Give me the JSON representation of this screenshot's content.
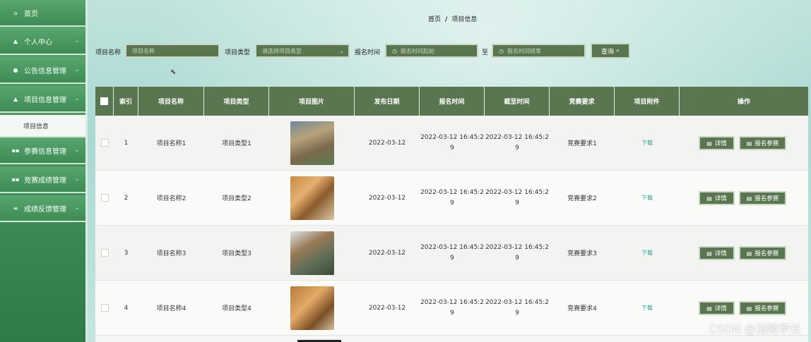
{
  "sidebar": {
    "items": [
      {
        "label": "首页",
        "icon": "home-icon",
        "glyph": "⌂"
      },
      {
        "label": "个人中心",
        "icon": "user-icon",
        "glyph": "▲"
      },
      {
        "label": "公告信息管理",
        "icon": "pin-icon",
        "glyph": "●"
      },
      {
        "label": "项目信息管理",
        "icon": "user-icon",
        "glyph": "▲"
      },
      {
        "label": "参赛信息管理",
        "icon": "grid-icon",
        "glyph": "▪▪"
      },
      {
        "label": "竞赛成绩管理",
        "icon": "grid-icon",
        "glyph": "▪▪"
      },
      {
        "label": "成绩反馈管理",
        "icon": "menu-icon",
        "glyph": "≡"
      }
    ],
    "subitem": "项目信息"
  },
  "breadcrumb": {
    "home": "首页",
    "sep": "/",
    "current": "项目信息"
  },
  "search": {
    "name_label": "项目名称",
    "name_placeholder": "项目名称",
    "type_label": "项目类型",
    "type_placeholder": "请选择项目类型",
    "time_label": "报名时间",
    "start_placeholder": "报名时间起始",
    "to_label": "至",
    "end_placeholder": "报名时间结束",
    "button": "查询"
  },
  "table": {
    "headers": [
      "索引",
      "项目名称",
      "项目类型",
      "项目图片",
      "发布日期",
      "报名时间",
      "截至时间",
      "竞赛要求",
      "项目附件",
      "操作"
    ],
    "rows": [
      {
        "index": "1",
        "name": "项目名称1",
        "type": "项目类型1",
        "date": "2022-03-12",
        "start_a": "2022-03-12 16:45:2",
        "start_b": "9",
        "end_a": "2022-03-12 16:45:2",
        "end_b": "9",
        "req": "竞赛要求1",
        "file": "下载"
      },
      {
        "index": "2",
        "name": "项目名称2",
        "type": "项目类型2",
        "date": "2022-03-12",
        "start_a": "2022-03-12 16:45:2",
        "start_b": "9",
        "end_a": "2022-03-12 16:45:2",
        "end_b": "9",
        "req": "竞赛要求2",
        "file": "下载"
      },
      {
        "index": "3",
        "name": "项目名称3",
        "type": "项目类型3",
        "date": "2022-03-12",
        "start_a": "2022-03-12 16:45:2",
        "start_b": "9",
        "end_a": "2022-03-12 16:45:2",
        "end_b": "9",
        "req": "竞赛要求3",
        "file": "下载"
      },
      {
        "index": "4",
        "name": "项目名称4",
        "type": "项目类型4",
        "date": "2022-03-12",
        "start_a": "2022-03-12 16:45:2",
        "start_b": "9",
        "end_a": "2022-03-12 16:45:2",
        "end_b": "9",
        "req": "竞赛要求4",
        "file": "下载"
      }
    ],
    "actions": {
      "detail": "详情",
      "signup": "报名参赛"
    }
  },
  "watermark": "CSDN @涪陵学长",
  "colors": {
    "sidebar": "#4a9960",
    "header": "#5a7651",
    "link": "#2a9d8f"
  }
}
